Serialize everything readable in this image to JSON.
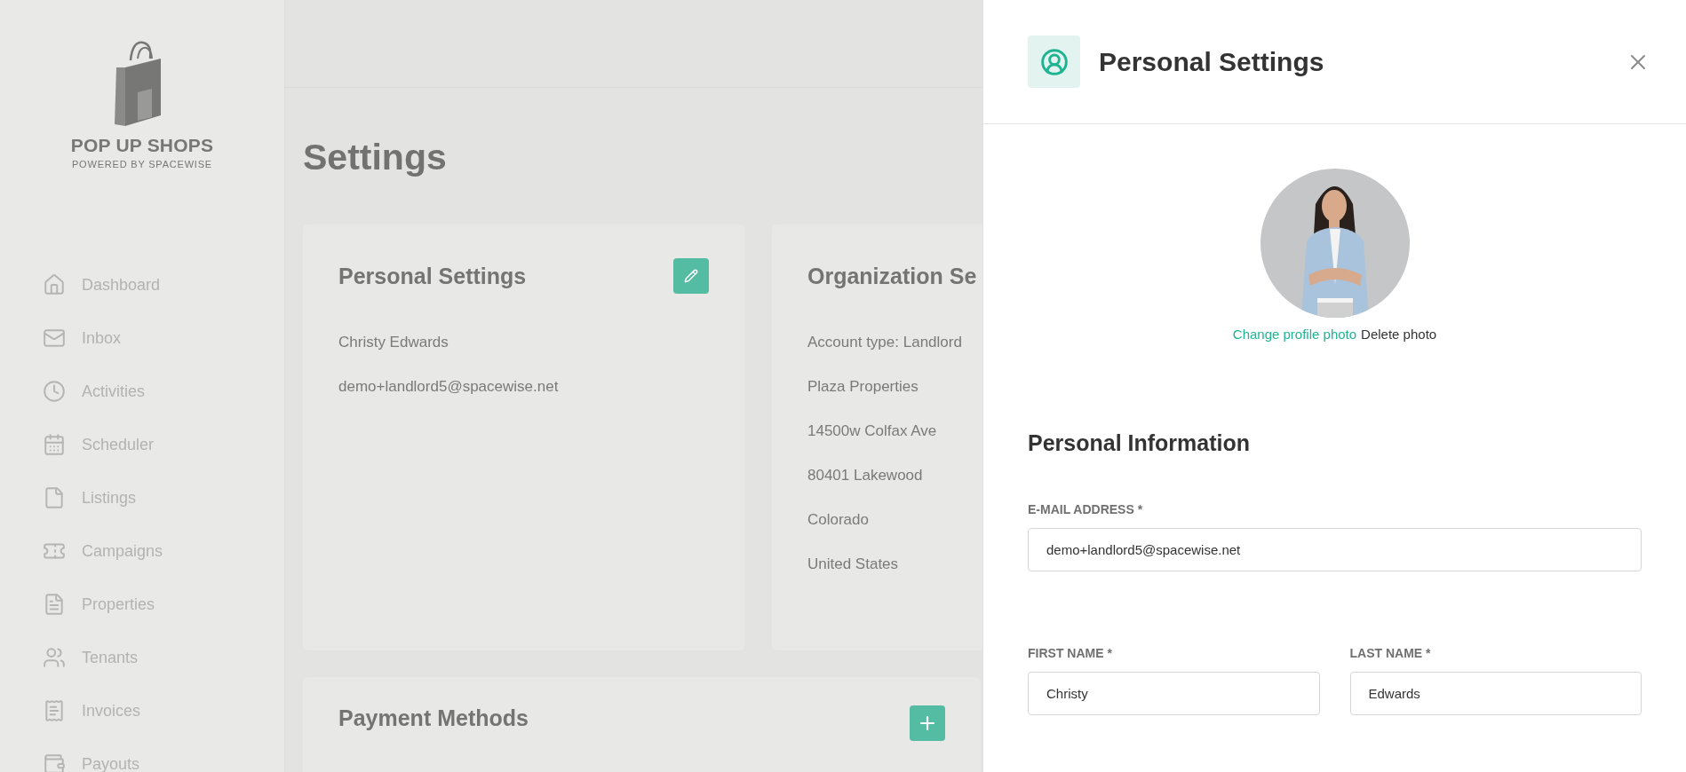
{
  "logo": {
    "title": "POP UP SHOPS",
    "subtitle": "POWERED BY SPACEWISE"
  },
  "sidebar": {
    "items": [
      {
        "label": "Dashboard"
      },
      {
        "label": "Inbox"
      },
      {
        "label": "Activities"
      },
      {
        "label": "Scheduler"
      },
      {
        "label": "Listings"
      },
      {
        "label": "Campaigns"
      },
      {
        "label": "Properties"
      },
      {
        "label": "Tenants"
      },
      {
        "label": "Invoices"
      },
      {
        "label": "Payouts"
      }
    ]
  },
  "page": {
    "title": "Settings"
  },
  "cards": [
    {
      "title": "Personal Settings",
      "kind": "editable",
      "lines": [
        "Christy Edwards",
        "demo+landlord5@spacewise.net"
      ]
    },
    {
      "title": "Organization Se",
      "kind": "plain",
      "lines": [
        "Account type: Landlord",
        "Plaza Properties",
        "14500w Colfax Ave",
        "80401 Lakewood",
        "Colorado",
        "United States"
      ]
    }
  ],
  "payment": {
    "title": "Payment Methods",
    "kind": "addable"
  },
  "drawer": {
    "title": "Personal Settings",
    "change_photo": "Change profile photo",
    "delete_photo": "Delete photo",
    "section": "Personal Information",
    "fields": [
      {
        "label": "E-MAIL ADDRESS *",
        "value": "demo+landlord5@spacewise.net"
      },
      {
        "label": "FIRST NAME *",
        "value": "Christy"
      },
      {
        "label": "LAST NAME *",
        "value": "Edwards"
      }
    ]
  }
}
